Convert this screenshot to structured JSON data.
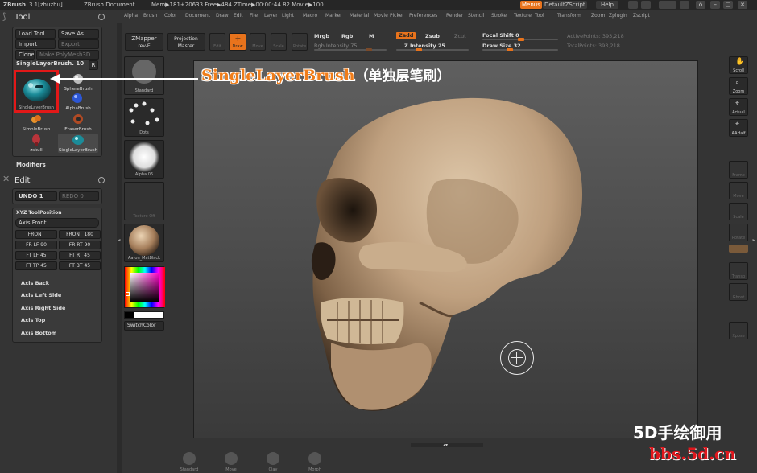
{
  "titlebar": {
    "app_name": "ZBrush",
    "version": "3.1[zhuzhu]",
    "document": "ZBrush Document",
    "mem": "Mem▶181+20633 Free▶484 ZTime▶00:00:44.82 Movie▶100",
    "menus_button": "Menus",
    "script_button": "DefaultZScript",
    "help_button": "Help"
  },
  "menubar": [
    "Alpha",
    "Brush",
    "Color",
    "Document",
    "Draw",
    "Edit",
    "File",
    "Layer",
    "Light",
    "Macro",
    "Marker",
    "Material",
    "Movie",
    "Picker",
    "Preferences",
    "Render",
    "Stencil",
    "Stroke",
    "Texture",
    "Tool",
    "Transform",
    "Zoom",
    "Zplugin",
    "Zscript"
  ],
  "tool_panel": {
    "title": "Tool",
    "load_tool": "Load Tool",
    "save_as": "Save As",
    "import": "Import",
    "export": "Export",
    "clone": "Clone",
    "make_polymesh": "Make PolyMesh3D",
    "current_tool": "SingleLayerBrush. 10",
    "r_button": "R",
    "selected_tool_label": "SingleLayerBrush",
    "brushes": [
      {
        "name": "SphereBrush",
        "icon": "sphere-brush-icon"
      },
      {
        "name": "AlphaBrush",
        "icon": "alpha-brush-icon"
      },
      {
        "name": "SimpleBrush",
        "icon": "simple-brush-icon"
      },
      {
        "name": "EraserBrush",
        "icon": "eraser-brush-icon"
      },
      {
        "name": "zskull",
        "icon": "zskull-icon"
      },
      {
        "name": "SingleLayerBrush",
        "icon": "single-layer-brush-icon"
      }
    ],
    "modifiers": "Modifiers"
  },
  "edit_panel": {
    "title": "Edit",
    "undo": "UNDO 1",
    "redo": "REDO 0"
  },
  "xyz_panel": {
    "title": "XYZ ToolPosition",
    "axis_front": "Axis Front",
    "buttons": [
      "FRONT",
      "FRONT 180",
      "FR LF 90",
      "FR RT 90",
      "FT LF 45",
      "FT RT 45",
      "FT TP 45",
      "FT BT 45"
    ],
    "axes": [
      "Axis Back",
      "Axis Left Side",
      "Axis Right Side",
      "Axis Top",
      "Axis Bottom"
    ]
  },
  "shelf": {
    "zmapper": "ZMapper",
    "zmapper_sub": "rev-E",
    "projection": "Projection",
    "projection_sub": "Master",
    "edit": "Edit",
    "draw": "Draw",
    "move": "Move",
    "scale": "Scale",
    "rotate": "Rotate",
    "mrgb": "Mrgb",
    "rgb": "Rgb",
    "m": "M",
    "rgb_intensity": "Rgb Intensity 75",
    "zadd": "Zadd",
    "zsub": "Zsub",
    "zcut": "Zcut",
    "z_intensity": "Z Intensity 25",
    "focal_shift": "Focal Shift 0",
    "draw_size": "Draw Size 32",
    "active_points": "ActivePoints: 393,218",
    "total_points": "TotalPoints: 393,218"
  },
  "left_shelf": {
    "standard": "Standard",
    "dots": "Dots",
    "alpha": "Alpha 06",
    "texture": "Texture Off",
    "material": "Aaron_MatBlack",
    "switch_color": "SwitchColor"
  },
  "right_shelf": [
    "Scroll",
    "Zoom",
    "Actual",
    "AAHalf",
    "Frame",
    "Move",
    "Scale",
    "Rotate",
    "Transp",
    "Ghost",
    "Xpose"
  ],
  "bottom_shelf": [
    "Standard",
    "Move",
    "Clay",
    "Morph"
  ],
  "annotation": {
    "label": "SingleLayerBrush",
    "cn": "（单独层笔刷）",
    "color": "#f07d1a"
  },
  "watermark": {
    "line1": "5D手绘御用",
    "line2": "bbs.5d.cn"
  }
}
